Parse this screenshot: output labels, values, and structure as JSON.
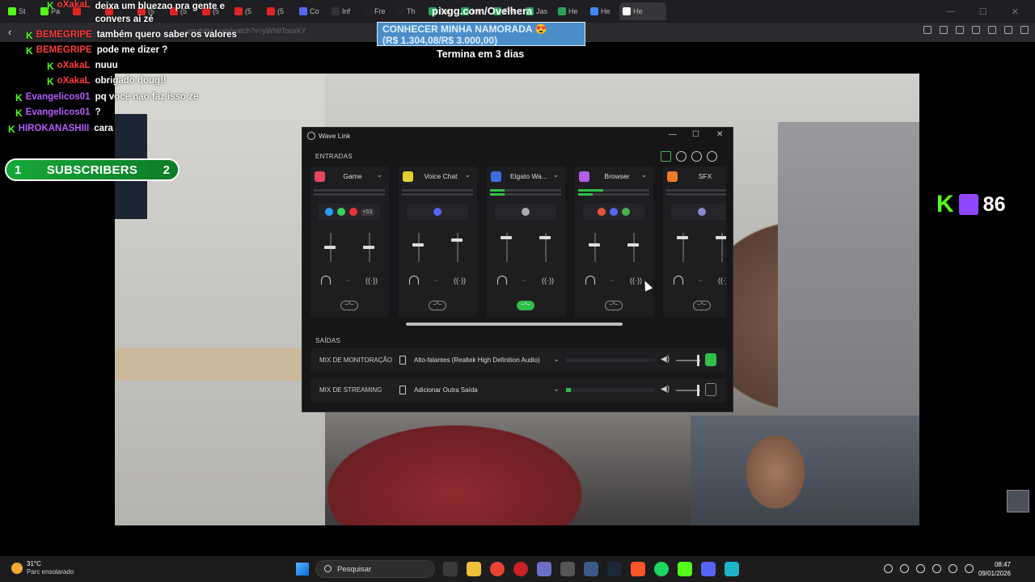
{
  "browser": {
    "tabs": [
      "St",
      "Pa",
      "",
      "",
      "(5",
      "(5",
      "(5",
      "(5",
      "(5",
      "Co",
      "Inf",
      "Fre",
      "Th",
      "Fre",
      "Inv",
      "Fre",
      "Jas",
      "He",
      "He",
      "He"
    ],
    "url": "youtube.com/watch?v=yWNllTonxKY",
    "back_glyph": "‹"
  },
  "donation": {
    "pix_url": "pixgg.com/Ovelhera",
    "goal_title": "CONHECER MINHA NAMORADA 😍",
    "goal_amount": "(R$ 1.304,08/R$ 3.000,00)",
    "ends_text": "Termina em 3 dias"
  },
  "chat": {
    "messages": [
      {
        "user": "oXakaL",
        "color": "#ff3b3b",
        "text": "deixa um bluezao pra gente e convers ai zé",
        "badge": "K"
      },
      {
        "user": "BEMEGRIPE",
        "color": "#ff3b3b",
        "text": "também quero saber os valores",
        "badge": "K"
      },
      {
        "user": "BEMEGRIPE",
        "color": "#ff3b3b",
        "text": "pode me dizer ?",
        "badge": "K"
      },
      {
        "user": "oXakaL",
        "color": "#ff3b3b",
        "text": "nuuu",
        "badge": "K"
      },
      {
        "user": "oXakaL",
        "color": "#ff3b3b",
        "text": "obrigado doug!!",
        "badge": "K"
      },
      {
        "user": "Evangelicos01",
        "color": "#b55bff",
        "text": "pq voce nao faz isso ze",
        "badge": "K"
      },
      {
        "user": "Evangelicos01",
        "color": "#b55bff",
        "text": "?",
        "badge": "K"
      },
      {
        "user": "HIROKANASHIII",
        "color": "#b55bff",
        "text": "cara",
        "badge": "K"
      }
    ]
  },
  "subscribers": {
    "label": "SUBSCRIBERS",
    "current": "1",
    "goal": "2"
  },
  "viewer_count": {
    "value": "86",
    "kick_glyph": "K"
  },
  "wavelink": {
    "title": "Wave Link",
    "entradas_label": "ENTRADAS",
    "saidas_label": "SAÍDAS",
    "ctl_min": "—",
    "ctl_max": "☐",
    "ctl_close": "✕",
    "channels": [
      {
        "name": "Game",
        "color": "#e8475c",
        "meter1": 0,
        "meter2": 0,
        "apps": [
          "#2a9df4",
          "#3ad15a",
          "#e8323f"
        ],
        "more": "+53",
        "fx_on": false,
        "fader_a": 0.45,
        "fader_b": 0.45
      },
      {
        "name": "Voice Chat",
        "color": "#e6cf2b",
        "meter1": 0,
        "meter2": 0,
        "apps": [
          "#5865f2"
        ],
        "more": "",
        "fx_on": false,
        "fader_a": 0.35,
        "fader_b": 0.2
      },
      {
        "name": "Elgato Wa...",
        "color": "#3a6fe0",
        "meter1": 0.2,
        "meter2": 0.2,
        "apps": [
          "#aaaaaa"
        ],
        "more": "",
        "fx_on": true,
        "fader_a": 0.1,
        "fader_b": 0.1
      },
      {
        "name": "Browser",
        "color": "#b45ee6",
        "meter1": 0.35,
        "meter2": 0.2,
        "apps": [
          "#e8533f",
          "#5865f2",
          "#4caf50"
        ],
        "more": "",
        "fx_on": false,
        "fader_a": 0.35,
        "fader_b": 0.35
      },
      {
        "name": "SFX",
        "color": "#ef7b2a",
        "meter1": 0,
        "meter2": 0,
        "apps": [
          "#8a8acf"
        ],
        "more": "",
        "fx_on": false,
        "fader_a": 0.1,
        "fader_b": 0.1
      }
    ],
    "outputs": [
      {
        "label": "MIX DE MONITORAÇÃO",
        "device": "Alto-falantes (Realtek High Definition Audio)",
        "level": 0,
        "ear_on": true
      },
      {
        "label": "MIX DE STREAMING",
        "device": "Adicionar Outra Saída",
        "level": 0.05,
        "ear_on": false
      }
    ],
    "fx_glyph": "~^~",
    "dropdown_glyph": "⌄"
  },
  "taskbar": {
    "temperature": "31°C",
    "weather_text": "Parc ensolarado",
    "search_placeholder": "Pesquisar",
    "time": "08:47",
    "date": "09/01/2026"
  },
  "colors": {
    "kick_green": "#53fc18",
    "accent_green": "#2fbf48",
    "twitch_purple": "#9146ff"
  }
}
